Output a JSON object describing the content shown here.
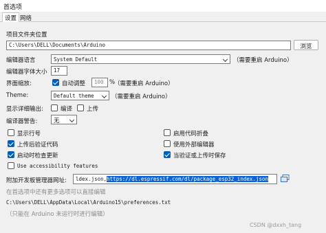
{
  "window": {
    "title": "首选项"
  },
  "tabs": [
    {
      "label": "设置"
    },
    {
      "label": "网络"
    }
  ],
  "sketchbook": {
    "label": "项目文件夹位置",
    "value": "C:\\Users\\DELL\\Documents\\Arduino",
    "browse_label": "浏览"
  },
  "editor_language": {
    "label": "编辑器语言",
    "value": "System Default",
    "note": "（需要重启 Arduino）"
  },
  "editor_font_size": {
    "label": "编辑器字体大小",
    "value": "17"
  },
  "interface_scale": {
    "label": "界面缩放:",
    "auto_label": "自动调整",
    "auto_checked": true,
    "value": "100",
    "unit": "%",
    "note": "（需要重启 Arduino）"
  },
  "theme": {
    "label": "Theme:",
    "value": "Default theme",
    "note": "（需要重启 Arduino）"
  },
  "verbose_output": {
    "label": "显示详细输出:",
    "compile_label": "编译",
    "compile_checked": false,
    "upload_label": "上传",
    "upload_checked": false
  },
  "compiler_warnings": {
    "label": "编译器警告:",
    "value": "无"
  },
  "options": [
    {
      "label": "显示行号",
      "checked": false
    },
    {
      "label": "启用代码折叠",
      "checked": false
    },
    {
      "label": "上传后验证代码",
      "checked": true
    },
    {
      "label": "使用外部编辑器",
      "checked": false
    },
    {
      "label": "启动时检查更新",
      "checked": true
    },
    {
      "label": "当验证或上传时保存",
      "checked": true
    },
    {
      "label": "Use accessibility features",
      "checked": false
    }
  ],
  "board_urls": {
    "label": "附加开发板管理器网址:",
    "value_prefix": "ldex.json,",
    "value_selected": "https://dl.espressif.com/dl/package_esp32_index.json"
  },
  "footer": {
    "edit_hint": "在首选项中还有更多选项可以直接编辑",
    "prefs_path": "C:\\Users\\DELL\\AppData\\Local\\Arduino15\\preferences.txt",
    "edit_note": "（只能在 Arduino 未运行时进行编辑）"
  },
  "watermark": "CSDN @dxxh_tang"
}
